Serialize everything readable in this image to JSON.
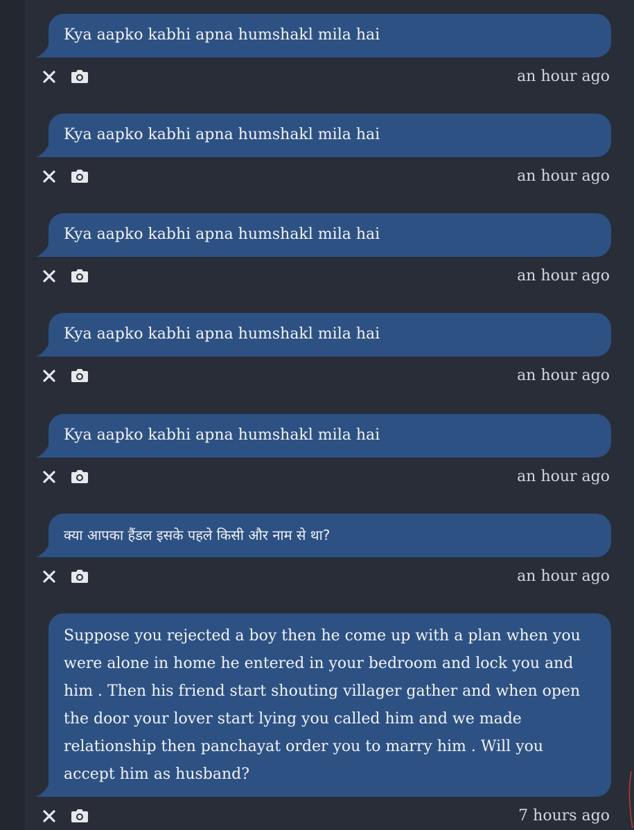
{
  "messages": [
    {
      "text": "Kya aapko kabhi apna humshakl mila hai",
      "time": "an hour ago"
    },
    {
      "text": "Kya aapko kabhi apna humshakl mila hai",
      "time": "an hour ago"
    },
    {
      "text": "Kya aapko kabhi apna humshakl mila hai",
      "time": "an hour ago"
    },
    {
      "text": "Kya aapko kabhi apna humshakl mila hai",
      "time": "an hour ago"
    },
    {
      "text": "Kya aapko kabhi apna humshakl mila hai",
      "time": "an hour ago"
    },
    {
      "text": "क्या आपका हैंडल इसके पहले किसी और नाम से था?",
      "time": "an hour ago"
    },
    {
      "text": "Suppose you rejected a boy then he come up with a plan when you were alone in home he entered in your bedroom and lock you and him . Then his friend start shouting villager gather and when open the door your lover start lying you called him and we made relationship then panchayat order you to marry him . Will you accept him as husband?",
      "time": "7 hours ago"
    }
  ],
  "icons": {
    "delete": "close-icon",
    "screenshot": "camera-icon"
  },
  "colors": {
    "background": "#282d38",
    "bubble": "#2e5183",
    "text": "#f1f3f6",
    "muted": "#d4d7dc"
  }
}
